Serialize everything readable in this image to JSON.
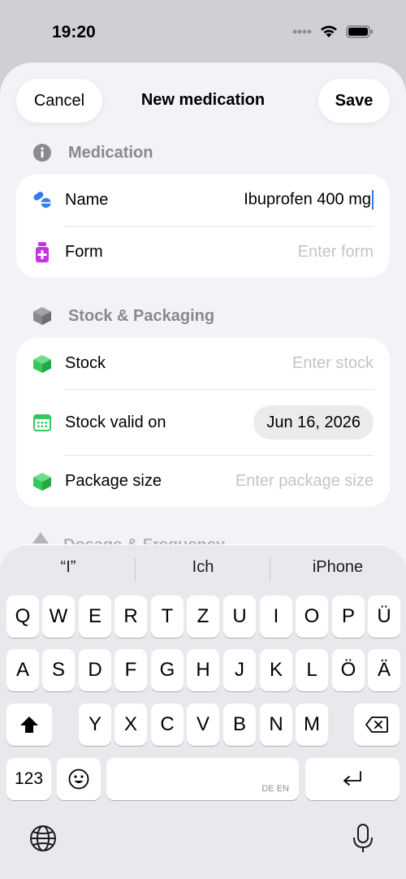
{
  "status": {
    "time": "19:20"
  },
  "nav": {
    "cancel_label": "Cancel",
    "title": "New medication",
    "save_label": "Save"
  },
  "sections": {
    "medication": {
      "header": "Medication",
      "name_label": "Name",
      "name_value": "Ibuprofen 400 mg",
      "form_label": "Form",
      "form_placeholder": "Enter form"
    },
    "stock": {
      "header": "Stock & Packaging",
      "stock_label": "Stock",
      "stock_placeholder": "Enter stock",
      "valid_label": "Stock valid on",
      "valid_value": "Jun 16, 2026",
      "package_label": "Package size",
      "package_placeholder": "Enter package size"
    },
    "dosage": {
      "header": "Dosage & Frequency"
    }
  },
  "keyboard": {
    "suggestions": [
      "“I”",
      "Ich",
      "iPhone"
    ],
    "row1": [
      "Q",
      "W",
      "E",
      "R",
      "T",
      "Z",
      "U",
      "I",
      "O",
      "P",
      "Ü"
    ],
    "row2": [
      "A",
      "S",
      "D",
      "F",
      "G",
      "H",
      "J",
      "K",
      "L",
      "Ö",
      "Ä"
    ],
    "row3": [
      "Y",
      "X",
      "C",
      "V",
      "B",
      "N",
      "M"
    ],
    "numbers_label": "123",
    "space_languages": "DE EN"
  },
  "colors": {
    "accent": "#2f7cf6",
    "form_icon": "#c632e0",
    "stock_icon": "#34c759"
  }
}
